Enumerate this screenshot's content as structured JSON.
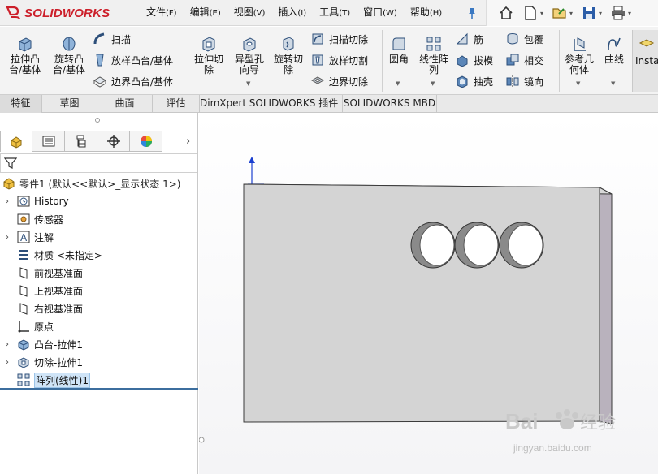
{
  "app": {
    "brand_text": "SOLIDWORKS",
    "accent": "#cc1f2a"
  },
  "menu": [
    {
      "label": "文件",
      "accel": "(F)"
    },
    {
      "label": "编辑",
      "accel": "(E)"
    },
    {
      "label": "视图",
      "accel": "(V)"
    },
    {
      "label": "插入",
      "accel": "(I)"
    },
    {
      "label": "工具",
      "accel": "(T)"
    },
    {
      "label": "窗口",
      "accel": "(W)"
    },
    {
      "label": "帮助",
      "accel": "(H)"
    }
  ],
  "quickbar": {
    "icons": [
      "home-icon",
      "new-document-icon",
      "open-folder-icon",
      "save-icon",
      "print-icon"
    ]
  },
  "ribbon": {
    "extrude_boss": "拉伸凸\n台/基体",
    "revolve_boss": "旋转凸\n台/基体",
    "sweep": "扫描",
    "loft_boss": "放样凸台/基体",
    "boundary_boss": "边界凸台/基体",
    "extrude_cut": "拉伸切\n除",
    "hole_wizard": "异型孔\n向导",
    "revolve_cut": "旋转切\n除",
    "swept_cut": "扫描切除",
    "lofted_cut": "放样切割",
    "boundary_cut": "边界切除",
    "fillet": "圆角",
    "linear_pattern": "线性阵\n列",
    "rib": "筋",
    "draft": "拔模",
    "shell": "抽壳",
    "wrap": "包覆",
    "intersect": "相交",
    "mirror": "镜向",
    "reference_geometry": "参考几\n何体",
    "curves": "曲线",
    "instant3d": "Instan"
  },
  "tabs": [
    {
      "label": "特征",
      "active": true
    },
    {
      "label": "草图",
      "active": false
    },
    {
      "label": "曲面",
      "active": false
    },
    {
      "label": "评估",
      "active": false
    },
    {
      "label": "DimXpert",
      "active": false
    },
    {
      "label": "SOLIDWORKS 插件",
      "active": false
    },
    {
      "label": "SOLIDWORKS MBD",
      "active": false
    }
  ],
  "feature_tree": {
    "root": "零件1 (默认<<默认>_显示状态 1>)",
    "items": [
      {
        "label": "History",
        "icon": "history-icon",
        "expandable": true
      },
      {
        "label": "传感器",
        "icon": "sensor-icon",
        "expandable": false
      },
      {
        "label": "注解",
        "icon": "annotation-icon",
        "expandable": true
      },
      {
        "label": "材质 <未指定>",
        "icon": "material-icon",
        "expandable": false
      },
      {
        "label": "前视基准面",
        "icon": "plane-icon",
        "expandable": false
      },
      {
        "label": "上视基准面",
        "icon": "plane-icon",
        "expandable": false
      },
      {
        "label": "右视基准面",
        "icon": "plane-icon",
        "expandable": false
      },
      {
        "label": "原点",
        "icon": "origin-icon",
        "expandable": false
      },
      {
        "label": "凸台-拉伸1",
        "icon": "boss-extrude-icon",
        "expandable": true
      },
      {
        "label": "切除-拉伸1",
        "icon": "cut-extrude-icon",
        "expandable": true
      },
      {
        "label": "阵列(线性)1",
        "icon": "linear-pattern-icon",
        "expandable": false,
        "selected": true
      }
    ]
  },
  "watermark": {
    "text": "jingyan.baidu.com",
    "brand": "Bai经验"
  }
}
